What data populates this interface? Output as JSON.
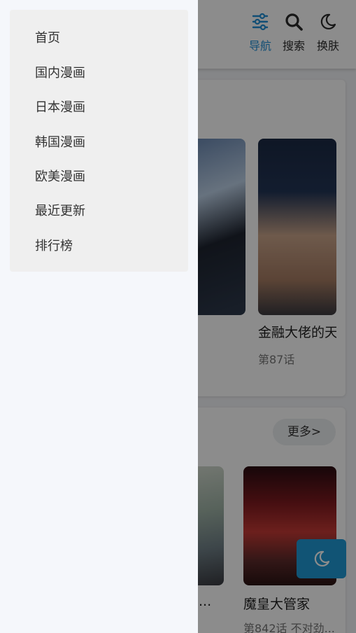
{
  "drawer": {
    "menu_items": [
      "首页",
      "国内漫画",
      "日本漫画",
      "韩国漫画",
      "欧美漫画",
      "最近更新",
      "排行榜"
    ]
  },
  "topbar": {
    "nav_label": "导航",
    "search_label": "搜索",
    "theme_label": "换肤",
    "active_color": "#1f8ed6"
  },
  "sections": {
    "first": {
      "comic_title": "金融大佬的天",
      "comic_chapter": "第87话"
    },
    "second": {
      "more_label": "更多>",
      "left_caption_partial": "...",
      "comic_title": "魔皇大管家",
      "comic_chapter": "第842话 不对劲..."
    }
  },
  "icons": {
    "nav": "sliders-icon",
    "search": "search-icon",
    "theme": "moon-icon",
    "fab": "moon-icon"
  }
}
